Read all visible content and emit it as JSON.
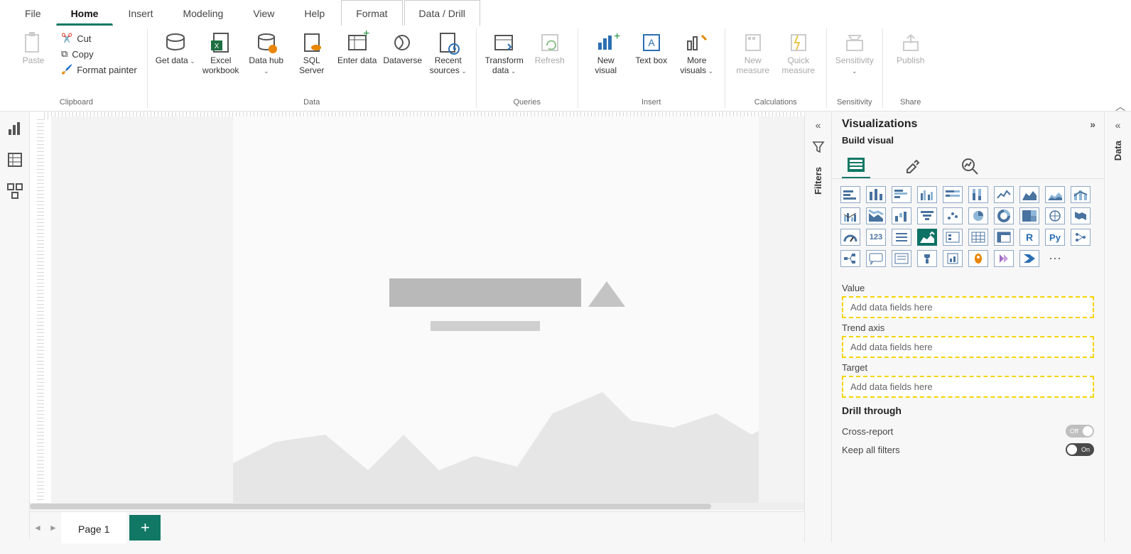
{
  "tabs": {
    "file": "File",
    "home": "Home",
    "insert": "Insert",
    "modeling": "Modeling",
    "view": "View",
    "help": "Help",
    "format": "Format",
    "data_drill": "Data / Drill"
  },
  "clipboard": {
    "paste": "Paste",
    "cut": "Cut",
    "copy": "Copy",
    "painter": "Format painter",
    "group": "Clipboard"
  },
  "data_group": {
    "get": "Get data",
    "excel": "Excel workbook",
    "hub": "Data hub",
    "sql": "SQL Server",
    "enter": "Enter data",
    "dataverse": "Dataverse",
    "recent": "Recent sources",
    "group": "Data"
  },
  "queries": {
    "transform": "Transform data",
    "refresh": "Refresh",
    "group": "Queries"
  },
  "insert": {
    "visual": "New visual",
    "text": "Text box",
    "more": "More visuals",
    "group": "Insert"
  },
  "calc": {
    "measure": "New measure",
    "quick": "Quick measure",
    "group": "Calculations"
  },
  "sens": {
    "btn": "Sensitivity",
    "group": "Sensitivity"
  },
  "share": {
    "btn": "Publish",
    "group": "Share"
  },
  "filters_label": "Filters",
  "data_label": "Data",
  "viz": {
    "title": "Visualizations",
    "sub": "Build visual"
  },
  "wells": {
    "value": "Value",
    "trend": "Trend axis",
    "target": "Target",
    "placeholder": "Add data fields here"
  },
  "drill": {
    "title": "Drill through",
    "cross": "Cross-report",
    "keep": "Keep all filters"
  },
  "page": {
    "name": "Page 1"
  },
  "chev": "⌄"
}
